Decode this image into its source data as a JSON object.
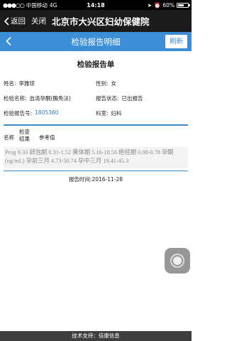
{
  "status": {
    "carrier": "中国移动",
    "network": "4G",
    "time": "14:18",
    "battery_pct": "60%",
    "battery_level": 0.6
  },
  "wechat_nav": {
    "back_label": "返回",
    "close_label": "关闭",
    "title": "北京市大兴区妇幼保健院"
  },
  "app_bar": {
    "title": "检验报告明细",
    "refresh_label": "刷新"
  },
  "report": {
    "title": "检验报告单",
    "name_label": "姓名:",
    "name_value": "李雅琼",
    "gender_label": "性别:",
    "gender_value": "女",
    "test_label": "检验名称:",
    "test_value": "血清孕酮(酶免法)",
    "status_label": "报告状态:",
    "status_value": "已出报告",
    "report_no_label": "检验报告号:",
    "report_no_value": "1805360",
    "dept_label": "科室:",
    "dept_value": "妇科",
    "col_name": "名称",
    "col_result": "检查结果",
    "col_ref": "参考值",
    "row_text": "Prog 9.33  卵泡期 0.31-1.52 黄体期 5.16-18.56 绝经期 0.08-0.78 孕酮 (ng/mL) 孕前三月 4.73-50.74 孕中三月 19.41-45.3",
    "time_label": "报告时间:",
    "time_value": "2016-11-28"
  },
  "footer": {
    "text": "技术支持：倍康信息"
  }
}
